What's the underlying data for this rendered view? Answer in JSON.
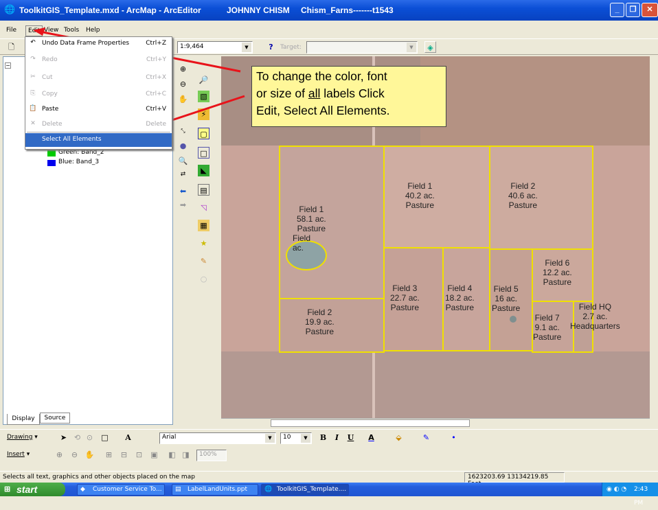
{
  "window": {
    "app_title": "ToolkitGIS_Template.mxd - ArcMap - ArcEditor",
    "user": "JOHNNY CHISM",
    "job": "Chism_Farns-------t1543",
    "buttons": [
      "minimize",
      "maximize",
      "close"
    ]
  },
  "menubar": {
    "file": "File",
    "edit": "Edit",
    "view": "View",
    "tools": "Tools",
    "help": "Help"
  },
  "toolbar": {
    "scale": "1:9,464",
    "target_label": "Target:"
  },
  "edit_menu": {
    "items": [
      {
        "label": "Undo Data Frame Properties",
        "shortcut": "Ctrl+Z",
        "enabled": true,
        "icon": "undo-icon"
      },
      {
        "label": "Redo",
        "shortcut": "Ctrl+Y",
        "enabled": false,
        "icon": "redo-icon"
      },
      {
        "label": "Cut",
        "shortcut": "Ctrl+X",
        "enabled": false,
        "icon": "cut-icon"
      },
      {
        "label": "Copy",
        "shortcut": "Ctrl+C",
        "enabled": false,
        "icon": "copy-icon"
      },
      {
        "label": "Paste",
        "shortcut": "Ctrl+V",
        "enabled": true,
        "icon": "paste-icon"
      },
      {
        "label": "Delete",
        "shortcut": "Delete",
        "enabled": false,
        "icon": "delete-icon"
      },
      {
        "label": "Select All Elements",
        "shortcut": "",
        "enabled": true,
        "highlighted": true
      }
    ]
  },
  "toc": {
    "layers": [
      {
        "label": "Green:  Band_2",
        "color": "#00cc00"
      },
      {
        "label": "Blue:  Band_3",
        "color": "#0000ee"
      }
    ],
    "tabs": {
      "display": "Display",
      "source": "Source"
    }
  },
  "callout": {
    "line1": "To change the color, font",
    "line2_pre": "or size of ",
    "line2_u": "all",
    "line2_post": " labels Click",
    "line3": "Edit, Select All Elements."
  },
  "map_labels": [
    {
      "id": "field1-main",
      "lines": [
        "Field  1",
        "40.2 ac.",
        "Pasture"
      ]
    },
    {
      "id": "field2-main",
      "lines": [
        "Field  2",
        "40.6 ac.",
        "Pasture"
      ]
    },
    {
      "id": "field1-west",
      "lines": [
        "Field  1",
        "58.1 ac.",
        "Pasture"
      ]
    },
    {
      "id": "field-pond",
      "lines": [
        "Field",
        "ac."
      ]
    },
    {
      "id": "field6",
      "lines": [
        "Field  6",
        "12.2 ac.",
        "Pasture"
      ]
    },
    {
      "id": "field3",
      "lines": [
        "Field  3",
        "22.7 ac.",
        "Pasture"
      ]
    },
    {
      "id": "field4",
      "lines": [
        "Field  4",
        "18.2 ac.",
        "Pasture"
      ]
    },
    {
      "id": "field5",
      "lines": [
        "Field  5",
        "16 ac.",
        "Pasture"
      ]
    },
    {
      "id": "field2-south",
      "lines": [
        "Field  2",
        "19.9 ac.",
        "Pasture"
      ]
    },
    {
      "id": "field7",
      "lines": [
        "Field  7",
        "9.1 ac.",
        "Pasture"
      ]
    },
    {
      "id": "field-hq",
      "lines": [
        "Field  HQ",
        "2.7 ac.",
        "Headquarters"
      ]
    }
  ],
  "draw_toolbar": {
    "drawing": "Drawing",
    "font": "Arial",
    "size": "10",
    "bold": "B",
    "italic": "I",
    "underline": "U",
    "zoom": "100%"
  },
  "insert_toolbar": {
    "insert": "Insert"
  },
  "status": {
    "message": "Selects all text, graphics and other objects placed on the map",
    "coords": "1623203.69  13134219.85 Feet"
  },
  "taskbar": {
    "start": "start",
    "tasks": [
      "Customer Service To...",
      "LabelLandUnits.ppt",
      "ToolkitGIS_Template...."
    ],
    "clock": "2:43 PM"
  }
}
